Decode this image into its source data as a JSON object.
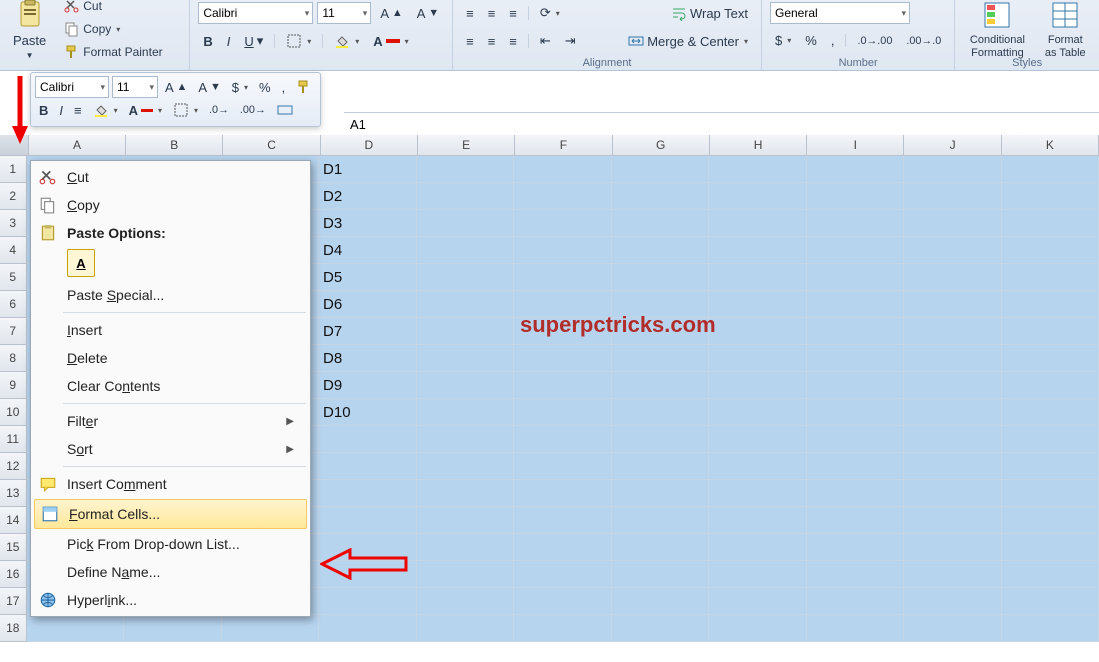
{
  "ribbon": {
    "paste_label": "Paste",
    "cut_label": "Cut",
    "copy_label": "Copy",
    "format_painter_label": "Format Painter",
    "font_name": "Calibri",
    "font_size": "11",
    "wrap_text": "Wrap Text",
    "merge_center": "Merge & Center",
    "number_format": "General",
    "conditional_formatting": "Conditional Formatting",
    "format_as_table": "Format as Table",
    "group_alignment": "Alignment",
    "group_number": "Number",
    "group_styles": "Styles"
  },
  "mini": {
    "font_name": "Calibri",
    "font_size": "11",
    "percent": "%",
    "comma": ","
  },
  "formula_bar": {
    "name_box": "A1"
  },
  "columns": [
    "A",
    "B",
    "C",
    "D",
    "E",
    "F",
    "G",
    "H",
    "I",
    "J",
    "K"
  ],
  "rows": [
    1,
    2,
    3,
    4,
    5,
    6,
    7,
    8,
    9,
    10,
    11,
    12,
    13,
    14,
    15,
    16,
    17,
    18
  ],
  "cells": {
    "D": [
      "D1",
      "D2",
      "D3",
      "D4",
      "D5",
      "D6",
      "D7",
      "D8",
      "D9",
      "D10"
    ]
  },
  "context_menu": {
    "cut": "Cut",
    "copy": "Copy",
    "paste_options": "Paste Options:",
    "paste_special": "Paste Special...",
    "insert": "Insert",
    "delete": "Delete",
    "clear_contents": "Clear Contents",
    "filter": "Filter",
    "sort": "Sort",
    "insert_comment": "Insert Comment",
    "format_cells": "Format Cells...",
    "pick_list": "Pick From Drop-down List...",
    "define_name": "Define Name...",
    "hyperlink": "Hyperlink..."
  },
  "watermark": "superpctricks.com"
}
